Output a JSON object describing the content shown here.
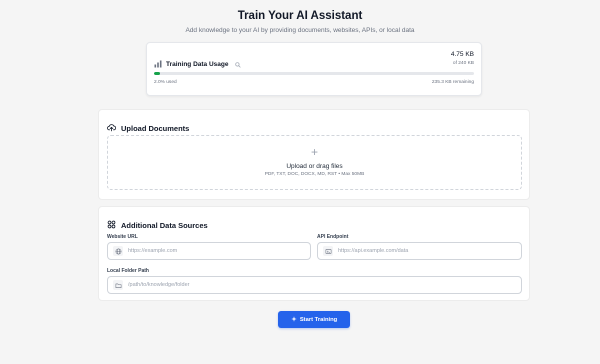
{
  "header": {
    "title": "Train Your AI Assistant",
    "subtitle": "Add knowledge to your AI by providing documents, websites, APIs, or local data"
  },
  "usage": {
    "label": "Training Data Usage",
    "amount": "4.75 KB",
    "of": "of 240 KB",
    "progress_percent": 2.0,
    "used_text": "2.0% used",
    "remaining_text": "235.3 KB remaining",
    "progress_color": "#16a34a"
  },
  "upload": {
    "title": "Upload Documents",
    "drop_title": "Upload or drag files",
    "drop_sub": "PDF, TXT, DOC, DOCX, MD, RST • Max 50MB",
    "plus": "+"
  },
  "sources": {
    "title": "Additional Data Sources",
    "website_label": "Website URL",
    "website_placeholder": "https://example.com",
    "api_label": "API Endpoint",
    "api_placeholder": "https://api.example.com/data",
    "folder_label": "Local Folder Path",
    "folder_placeholder": "/path/to/knowledge/folder"
  },
  "actions": {
    "start_label": "Start Training",
    "accent_color": "#2563eb"
  },
  "icons": {
    "usage": "bar-chart-icon",
    "info": "search-icon",
    "upload": "cloud-upload-icon",
    "sources": "grid-icon",
    "website": "globe-icon",
    "api": "code-icon",
    "folder": "folder-icon",
    "start": "sparkle-icon"
  }
}
